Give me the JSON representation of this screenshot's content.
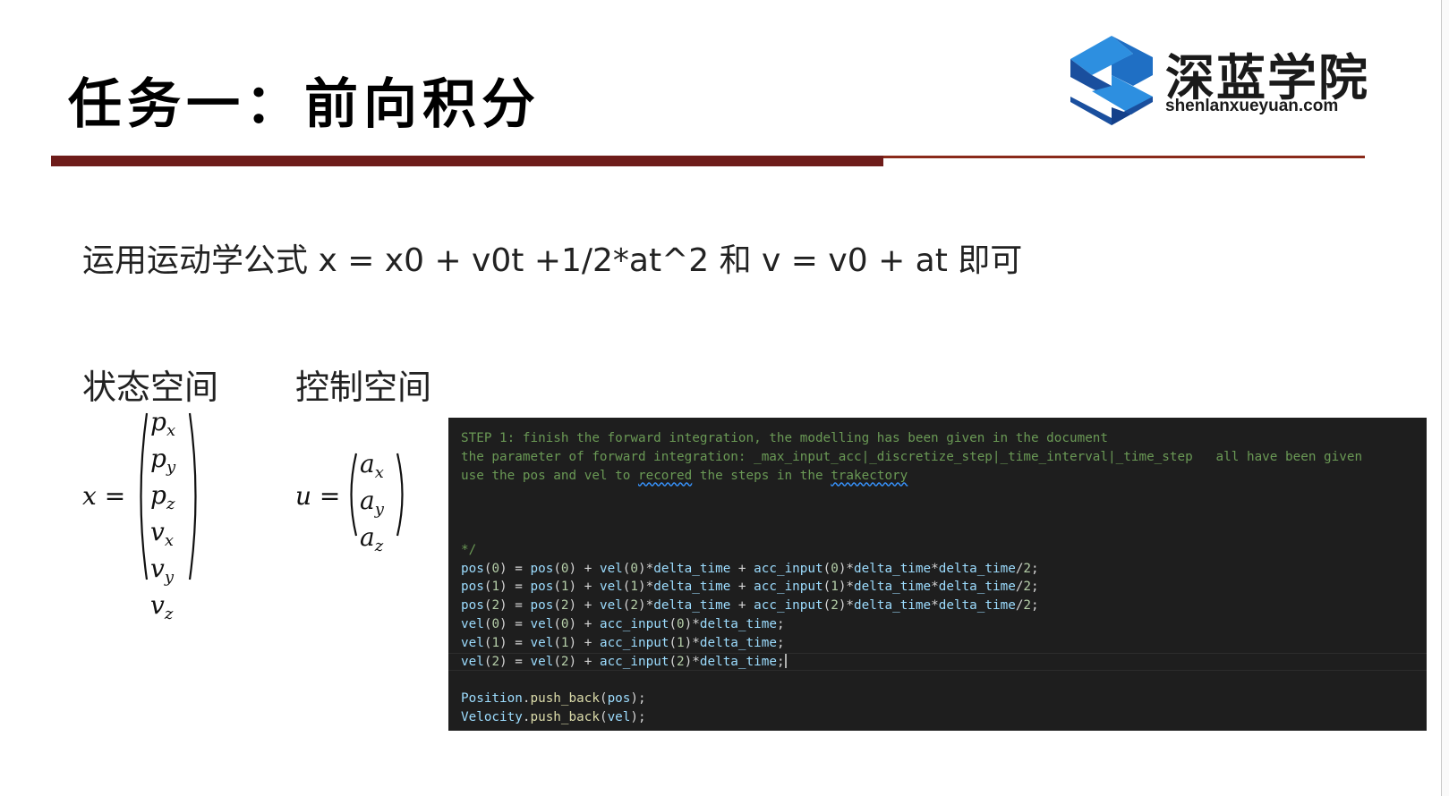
{
  "slide": {
    "title": "任务一：前向积分",
    "logo": {
      "name_cn": "深蓝学院",
      "name_en": "shenlanxueyuan.com"
    },
    "formula_line": "运用运动学公式 x = x0 + v0t +1/2*at^2 和 v = v0 + at 即可",
    "state_space_label": "状态空间",
    "control_space_label": "控制空间",
    "state_vector": {
      "lhs": "x =",
      "entries": [
        "p",
        "p",
        "p",
        "v",
        "v",
        "v"
      ],
      "subs": [
        "x",
        "y",
        "z",
        "x",
        "y",
        "z"
      ]
    },
    "control_vector": {
      "lhs": "u =",
      "entries": [
        "a",
        "a",
        "a"
      ],
      "subs": [
        "x",
        "y",
        "z"
      ]
    }
  },
  "code": {
    "comment_lines": [
      "STEP 1: finish the forward integration, the modelling has been given in the document",
      "the parameter of forward integration: _max_input_acc|_discretize_step|_time_interval|_time_step   all have been given",
      "use the pos and vel to ",
      "recored",
      " the steps in the ",
      "trakectory",
      "*/"
    ],
    "tokens": {
      "pos": "pos",
      "vel": "vel",
      "acc": "acc_input",
      "dt": "delta_time",
      "position": "Position",
      "velocity": "Velocity",
      "push_back": "push_back",
      "i0": "0",
      "i1": "1",
      "i2": "2",
      "two": "2"
    }
  }
}
